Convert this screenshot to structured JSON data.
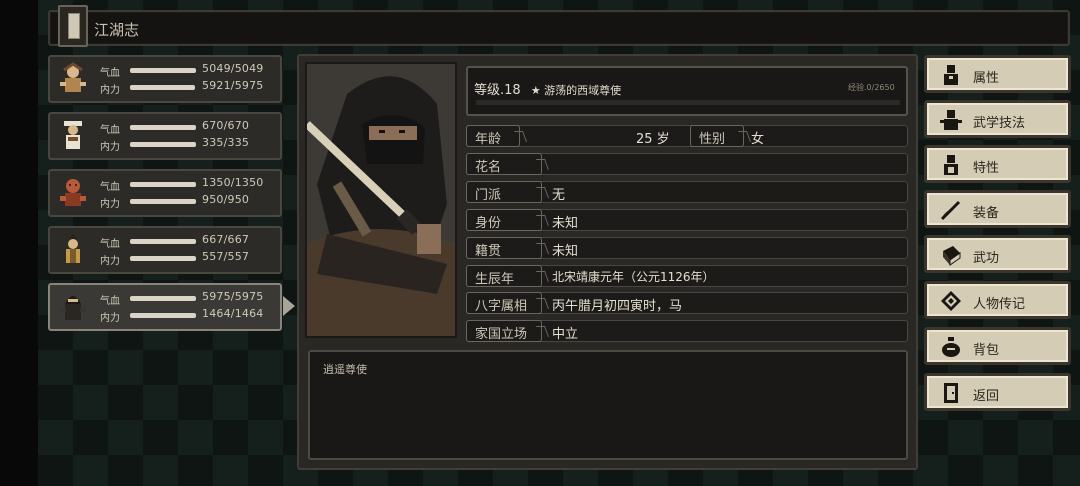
{
  "title": "江湖志",
  "party": [
    {
      "hp_label": "气血",
      "mp_label": "内力",
      "hp": "5049/5049",
      "mp": "5921/5975",
      "hp_fill": 1.0,
      "mp_fill": 0.99
    },
    {
      "hp_label": "气血",
      "mp_label": "内力",
      "hp": "670/670",
      "mp": "335/335",
      "hp_fill": 1.0,
      "mp_fill": 1.0
    },
    {
      "hp_label": "气血",
      "mp_label": "内力",
      "hp": "1350/1350",
      "mp": "950/950",
      "hp_fill": 1.0,
      "mp_fill": 1.0
    },
    {
      "hp_label": "气血",
      "mp_label": "内力",
      "hp": "667/667",
      "mp": "557/557",
      "hp_fill": 1.0,
      "mp_fill": 1.0
    },
    {
      "hp_label": "气血",
      "mp_label": "内力",
      "hp": "5975/5975",
      "mp": "1464/1464",
      "hp_fill": 1.0,
      "mp_fill": 1.0
    }
  ],
  "selected_index": 4,
  "character": {
    "level": "等级.18",
    "title": "★ 游荡的西域尊使",
    "exp": "经验.0/2650",
    "exp_fill": 0.0,
    "fields": {
      "age_label": "年龄",
      "age_value": "25 岁",
      "gender_label": "性别",
      "gender_value": "女",
      "nickname_label": "花名",
      "nickname_value": "",
      "sect_label": "门派",
      "sect_value": "无",
      "identity_label": "身份",
      "identity_value": "未知",
      "origin_label": "籍贯",
      "origin_value": "未知",
      "birth_label": "生辰年",
      "birth_value": "北宋靖康元年（公元1126年）",
      "bazi_label": "八字属相",
      "bazi_value": "丙午腊月初四寅时，马",
      "stance_label": "家国立场",
      "stance_value": "中立"
    },
    "description": "逍遥尊使"
  },
  "menu": [
    {
      "label": "属性",
      "icon": "person-icon"
    },
    {
      "label": "武学技法",
      "icon": "martial-person-icon"
    },
    {
      "label": "特性",
      "icon": "trait-person-icon"
    },
    {
      "label": "装备",
      "icon": "sword-icon"
    },
    {
      "label": "武功",
      "icon": "book-icon"
    },
    {
      "label": "人物传记",
      "icon": "scroll-icon"
    },
    {
      "label": "背包",
      "icon": "bag-icon"
    },
    {
      "label": "返回",
      "icon": "door-icon"
    }
  ],
  "colors": {
    "accent": "#d4ccb4",
    "panel": "#2a2825",
    "bar": "#d9d4c6"
  }
}
